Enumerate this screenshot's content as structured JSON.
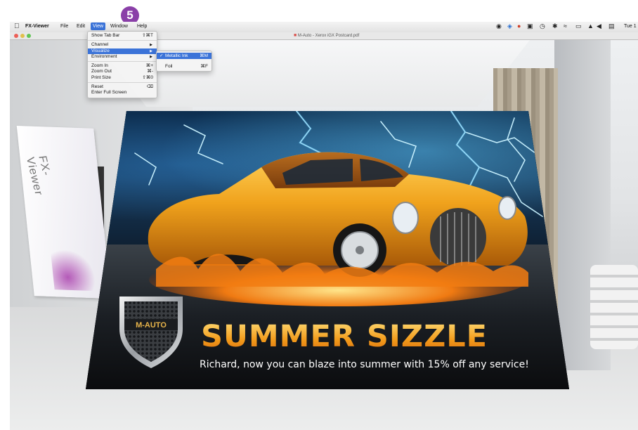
{
  "step_badge": "5",
  "menubar": {
    "app_name": "FX-Viewer",
    "items": [
      "File",
      "Edit",
      "View",
      "Window",
      "Help"
    ],
    "active_item": "View",
    "clock": "Tue 1"
  },
  "window": {
    "title": "M-Auto - Xerox iGX Postcard.pdf"
  },
  "view_menu": {
    "items": [
      {
        "label": "Show Tab Bar",
        "shortcut": "⇧⌘T"
      },
      {
        "label": "Channel",
        "submenu": true
      },
      {
        "label": "Visualize",
        "submenu": true
      },
      {
        "label": "Environment",
        "submenu": true
      },
      {
        "label": "Zoom In",
        "shortcut": "⌘+"
      },
      {
        "label": "Zoom Out",
        "shortcut": "⌘-"
      },
      {
        "label": "Print Size",
        "shortcut": "⇧⌘0"
      },
      {
        "label": "Reset",
        "shortcut": "⌫"
      },
      {
        "label": "Enter Full Screen",
        "shortcut": ""
      }
    ]
  },
  "visualize_submenu": {
    "items": [
      {
        "label": "Metallic Ink",
        "shortcut": "⌘M",
        "checked": true
      },
      {
        "label": "Foil",
        "shortcut": "⌘F",
        "checked": false
      }
    ]
  },
  "postcard": {
    "logo_text": "M-AUTO",
    "headline": "SUMMER SIZZLE",
    "subline": "Richard, now you can blaze into summer with 15% off any service!"
  },
  "background_board_text": "FX-Viewer",
  "colors": {
    "menu_highlight": "#3b73d8",
    "badge": "#8a3fa8",
    "headline_gold": "#f2a42a"
  }
}
